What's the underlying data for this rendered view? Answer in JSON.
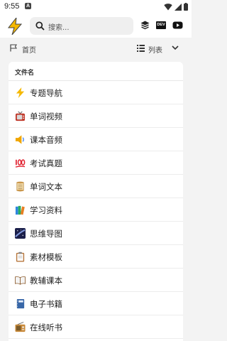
{
  "status": {
    "time": "9:55",
    "notification_letter": "A"
  },
  "header": {
    "search": {
      "placeholder": "搜索..."
    },
    "icons": [
      "lightning-logo",
      "layers-icon",
      "dev-icon",
      "youtube-icon"
    ],
    "dev_badge": "DEV"
  },
  "breadcrumb": {
    "label": "首页"
  },
  "view": {
    "label": "列表"
  },
  "list": {
    "header": "文件名",
    "items": [
      {
        "label": "专题导航",
        "icon": "lightning-icon"
      },
      {
        "label": "单词视频",
        "icon": "tv-icon"
      },
      {
        "label": "课本音频",
        "icon": "speaker-icon"
      },
      {
        "label": "考试真题",
        "icon": "hundred-points-icon"
      },
      {
        "label": "单词文本",
        "icon": "scroll-icon"
      },
      {
        "label": "学习资料",
        "icon": "books-icon"
      },
      {
        "label": "思维导图",
        "icon": "milky-way-icon"
      },
      {
        "label": "素材模板",
        "icon": "clipboard-icon"
      },
      {
        "label": "教辅课本",
        "icon": "open-book-icon"
      },
      {
        "label": "电子书籍",
        "icon": "notebook-icon"
      },
      {
        "label": "在线听书",
        "icon": "radio-icon"
      }
    ]
  },
  "colors": {
    "accent_yellow": "#f5b800",
    "text": "#222222",
    "background": "#f3f3f3"
  }
}
